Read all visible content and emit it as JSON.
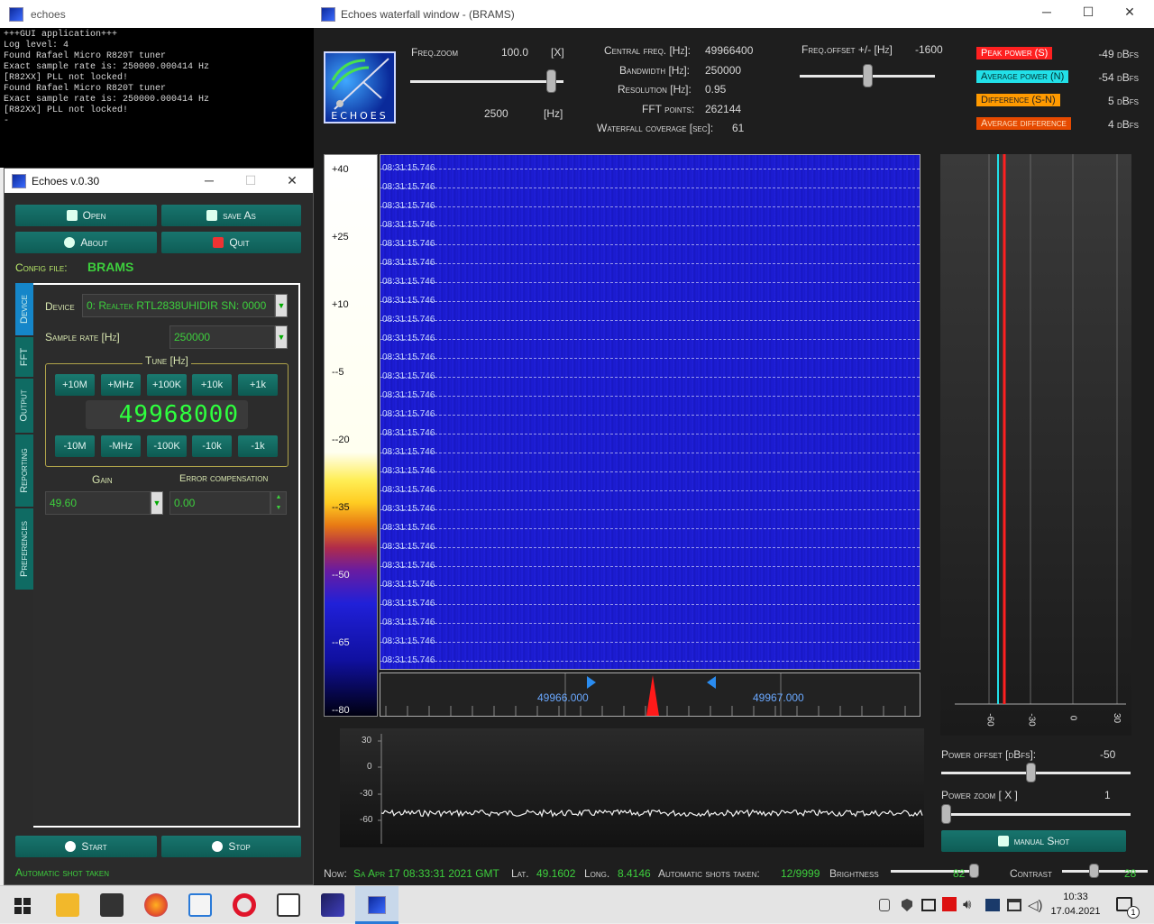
{
  "console": {
    "title": "echoes",
    "lines": "+++GUI application+++\nLog level: 4\nFound Rafael Micro R820T tuner\nExact sample rate is: 250000.000414 Hz\n[R82XX] PLL not locked!\nFound Rafael Micro R820T tuner\nExact sample rate is: 250000.000414 Hz\n[R82XX] PLL not locked!\n-"
  },
  "main": {
    "title": "Echoes v.0.30",
    "buttons": {
      "open": "Open",
      "save_as": "save As",
      "about": "About",
      "quit": "Quit",
      "start": "Start",
      "stop": "Stop"
    },
    "config_label": "Config file:",
    "config_value": "BRAMS",
    "tabs": [
      "Device",
      "FFT",
      "Output",
      "Reporting",
      "Preferences"
    ],
    "device_label": "Device",
    "device_value": "0: Realtek RTL2838UHIDIR  SN: 0000",
    "sample_rate_label": "Sample rate [Hz]",
    "sample_rate_value": "250000",
    "tune_label": "Tune [Hz]",
    "tune_up": [
      "+10M",
      "+MHz",
      "+100K",
      "+10k",
      "+1k"
    ],
    "tune_down": [
      "-10M",
      "-MHz",
      "-100K",
      "-10k",
      "-1k"
    ],
    "tune_display": "49968000",
    "gain_label": "Gain",
    "gain_value": "49.60",
    "error_label": "Error compensation",
    "error_value": "0.00",
    "status": "Automatic shot taken"
  },
  "waterfall_window": {
    "title": "Echoes waterfall window - (BRAMS)",
    "logo_text": "ECHOES",
    "freq_zoom_label": "Freq.zoom",
    "freq_zoom_value": "100.0",
    "freq_zoom_unit": "[X]",
    "freq_zoom_slider": 0.95,
    "span_value": "2500",
    "span_unit": "[Hz]",
    "central_freq_label": "Central freq. [Hz]:",
    "central_freq_value": "49966400",
    "bandwidth_label": "Bandwidth [Hz]:",
    "bandwidth_value": "250000",
    "resolution_label": "Resolution [Hz]:",
    "resolution_value": "0.95",
    "fft_points_label": "FFT points:",
    "fft_points_value": "262144",
    "coverage_label": "Waterfall coverage [sec]:",
    "coverage_value": "61",
    "freq_offset_label": "Freq.offset +/- [Hz]",
    "freq_offset_value": "-1600",
    "freq_offset_slider": 0.5,
    "legend": [
      {
        "label": "Peak power (S)",
        "value": "-49 dBfs",
        "color": "#ff2020",
        "text": "#ffffff"
      },
      {
        "label": "Average power (N)",
        "value": "-54 dBfs",
        "color": "#22e0e8",
        "text": "#003030"
      },
      {
        "label": "Difference (S-N)",
        "value": "5 dBfs",
        "color": "#ff9a00",
        "text": "#202020"
      },
      {
        "label": "Average difference",
        "value": "4 dBfs",
        "color": "#e64a00",
        "text": "#ffe0c0"
      }
    ],
    "colorbar_labels": [
      "+40",
      "+25",
      "+10",
      "--5",
      "--20",
      "--35",
      "--50",
      "--65",
      "--80"
    ],
    "timestamp": "08:31:15.746",
    "freq_ticks": [
      "49966.000",
      "49967.000"
    ],
    "spectrum_y": [
      "30",
      "0",
      "-30",
      "-60"
    ],
    "power_ticks": [
      "-60",
      "-30",
      "0",
      "30"
    ],
    "power_offset_label": "Power offset [dBfs]:",
    "power_offset_value": "-50",
    "power_offset_slider": 0.47,
    "power_zoom_label": "Power zoom  [ X ]",
    "power_zoom_value": "1",
    "power_zoom_slider": 0.0,
    "manual_shot": "manual Shot",
    "status": {
      "now_label": "Now:",
      "now_value": "Sa Apr 17 08:33:31 2021 GMT",
      "lat_label": "Lat.",
      "lat_value": "49.1602",
      "long_label": "Long.",
      "long_value": "8.4146",
      "shots_label": "Automatic shots taken:",
      "shots_value": "12/9999",
      "brightness_label": "Brightness",
      "brightness_value": "82",
      "contrast_label": "Contrast",
      "contrast_value": "28"
    }
  },
  "taskbar": {
    "clock_time": "10:33",
    "clock_date": "17.04.2021",
    "notification_count": "1"
  }
}
